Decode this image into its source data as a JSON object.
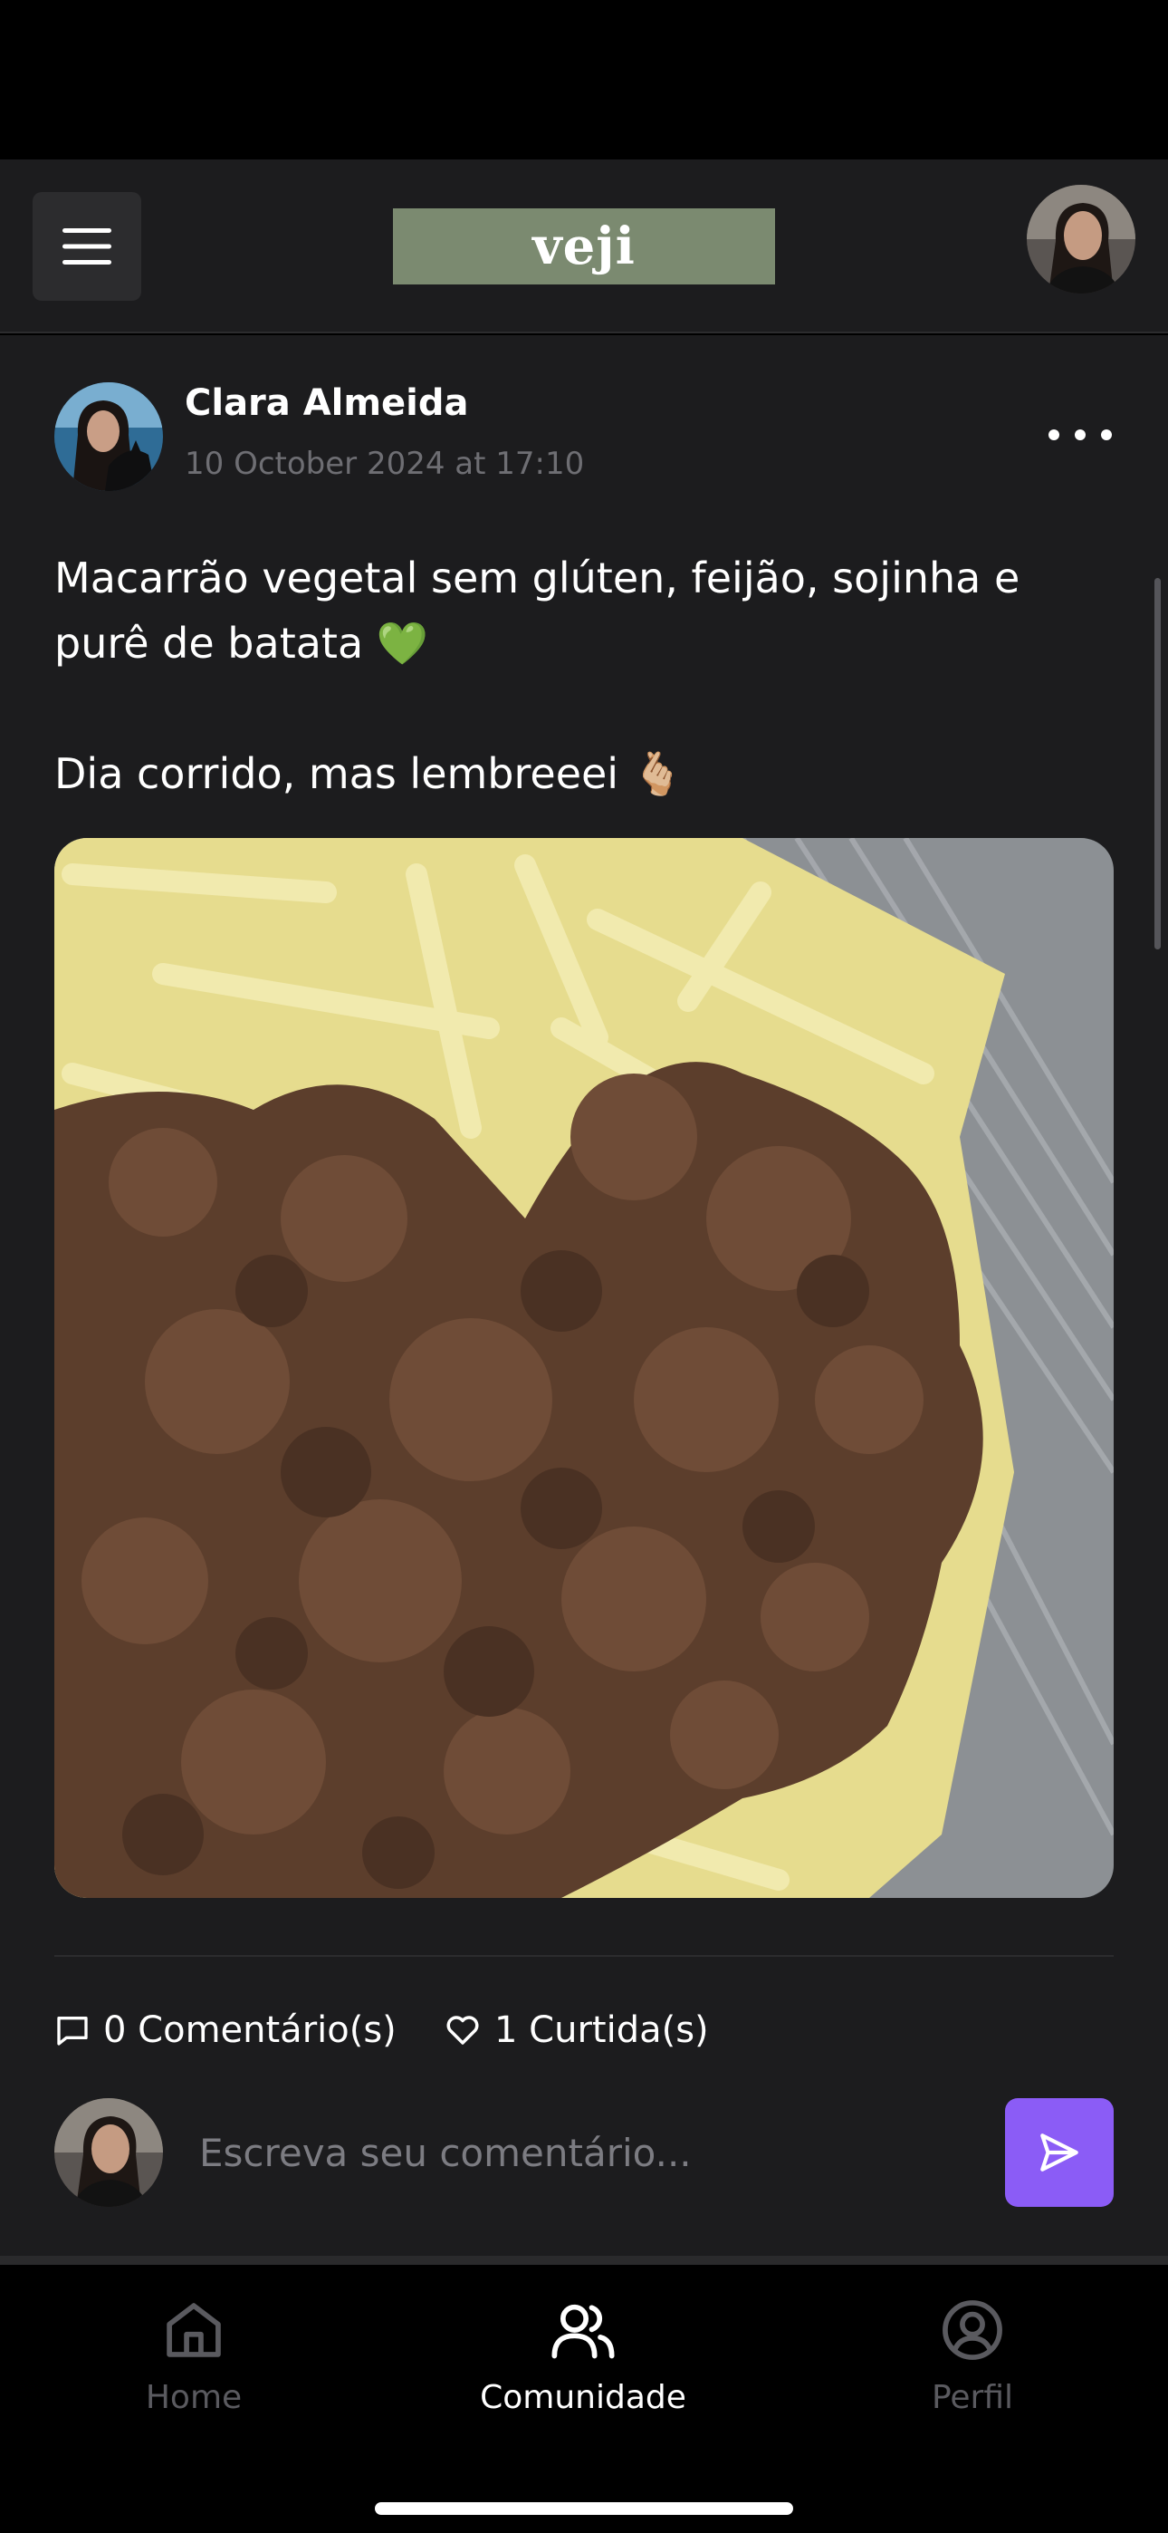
{
  "app": {
    "brand": "veji",
    "brand_color": "#7b8a70",
    "accent": "#8b5cf6"
  },
  "header": {
    "menu_icon": "hamburger-menu-icon",
    "user_avatar": "current-user-avatar"
  },
  "post": {
    "author": "Clara Almeida",
    "date": "10 October 2024 at 17:10",
    "text_line1": "Macarrão vegetal sem glúten, feijão, sojinha e purê de batata 💚",
    "text_line2": "Dia corrido, mas lembreeei 🫰🏼",
    "comments": "0 Comentário(s)",
    "likes": "1 Curtida(s)",
    "comment_placeholder": "Escreva seu comentário..."
  },
  "tabs": [
    {
      "label": "Home",
      "icon": "home-icon",
      "active": false
    },
    {
      "label": "Comunidade",
      "icon": "users-icon",
      "active": true
    },
    {
      "label": "Perfil",
      "icon": "user-circle-icon",
      "active": false
    }
  ]
}
